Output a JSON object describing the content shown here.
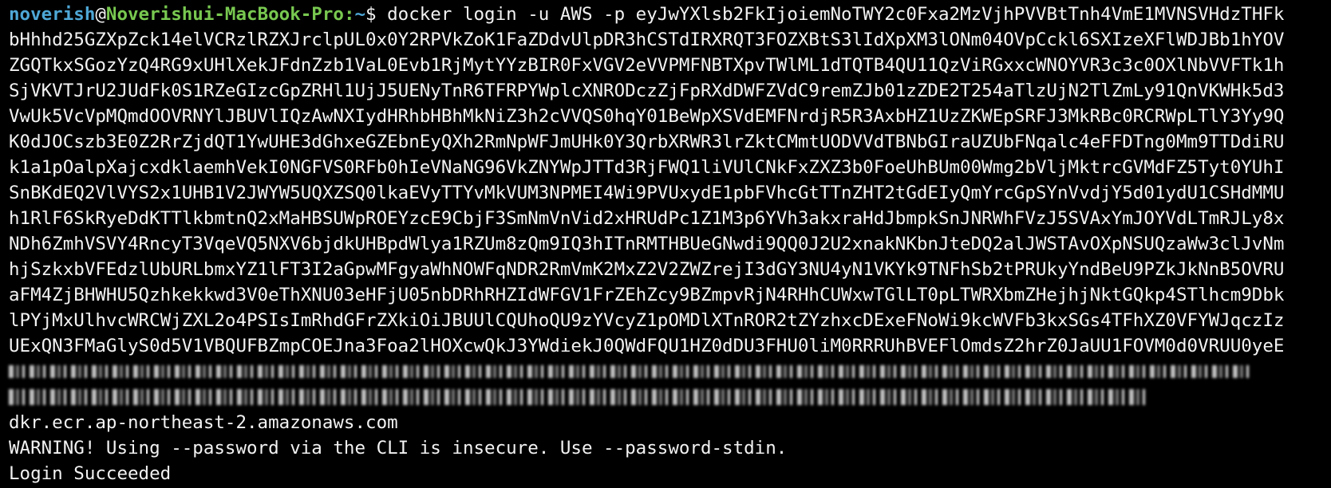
{
  "prompt": {
    "user": "noverish",
    "at": "@",
    "host": "Noverishui-MacBook-Pro",
    "colon": ":",
    "path": "~",
    "dollar": "$",
    "command": " docker login -u AWS -p eyJwYXlsb2FkIjoiemNoTWY2c0Fxa2MzVjhPVVBtTnh4VmE1MVNSVHdzTHFk"
  },
  "token_lines": [
    "bHhhd25GZXpZck14elVCRzlRZXJrclpUL0x0Y2RPVkZoK1FaZDdvUlpDR3hCSTdIRXRQT3FOZXBtS3lIdXpXM3lONm04OVpCckl6SXIzeXFlWDJBb1hYOV",
    "ZGQTkxSGozYzQ4RG9xUHlXekJFdnZzb1VaL0Evb1RjMytYYzBIR0FxVGV2eVVPMFNBTXpvTWlML1dTQTB4QU11QzViRGxxcWNOYVR3c3c0OXlNbVVFTk1h",
    "SjVKVTJrU2JUdFk0S1RZeGIzcGpZRHl1UjJ5UENyTnR6TFRPYWplcXNRODczZjFpRXdDWFZVdC9remZJb01zZDE2T254aTlzUjN2TlZmLy91QnVKWHk5d3",
    "VwUk5VcVpMQmdOOVRNYlJBUVlIQzAwNXIydHRhbHBhMkNiZ3h2cVVQS0hqY01BeWpXSVdEMFNrdjR5R3AxbHZ1UzZKWEpSRFJ3MkRBc0RCRWpLTlY3Yy9Q",
    "K0dJOCszb3E0Z2RrZjdQT1YwUHE3dGhxeGZEbnEyQXh2RmNpWFJmUHk0Y3QrbXRWR3lrZktCMmtUODVVdTBNbGIraUZUbFNqalc4eFFDTng0Mm9TTDdiRU",
    "k1a1pOalpXajcxdklaemhVekI0NGFVS0RFb0hIeVNaNG96VkZNYWpJTTd3RjFWQ1liVUlCNkFxZXZ3b0FoeUhBUm00Wmg2bVljMktrcGVMdFZ5Tyt0YUhI",
    "SnBKdEQ2VlVYS2x1UHB1V2JWYW5UQXZSQ0lkaEVyTTYvMkVUM3NPMEI4Wi9PVUxydE1pbFVhcGtTTnZHT2tGdEIyQmYrcGpSYnVvdjY5d01ydU1CSHdMMU",
    "h1RlF6SkRyeDdKTTlkbmtnQ2xMaHBSUWpROEYzcE9CbjF3SmNmVnVid2xHRUdPc1Z1M3p6YVh3akxraHdJbmpkSnJNRWhFVzJ5SVAxYmJOYVdLTmRJLy8x",
    "NDh6ZmhVSVY4RncyT3VqeVQ5NXV6bjdkUHBpdWlya1RZUm8zQm9IQ3hITnRMTHBUeGNwdi9QQ0J2U2xnakNKbnJteDQ2alJWSTAvOXpNSUQzaWw3clJvNm",
    "hjSzkxbVFEdzlUbURLbmxYZ1lFT3I2aGpwMFgyaWhNOWFqNDR2RmVmK2MxZ2V2ZWZrejI3dGY3NU4yN1VKYk9TNFhSb2tPRUkyYndBeU9PZkJkNnB5OVRU",
    "aFM4ZjBHWHU5Qzhkekkwd3V0eThXNU03eHFjU05nbDRhRHZIdWFGV1FrZEhZcy9BZmpvRjN4RHhCUWxwTGlLT0pLTWRXbmZHejhjNktGQkp4STlhcm9Dbk",
    "lPYjMxUlhvcWRCWjZXL2o4PSIsImRhdGFrZXkiOiJBUUlCQUhoQU9zYVcyZ1pOMDlXTnROR2tZYzhxcDExeFNoWi9kcWVFb3kxSGs4TFhXZ0VFYWJqczIz",
    "UExQN3FMaGlyS0d5V1VBQUFBZmpCOEJna3Foa2lHOXcwQkJ3YWdiekJ0QWdFQU1HZ0dDU3FHU0liM0RRRUhBVEFlOmdsZ2hrZ0JaUU1FOVM0d0VRUU0yeE"
  ],
  "redacted_label": "redacted text",
  "output_lines": [
    "dkr.ecr.ap-northeast-2.amazonaws.com",
    "WARNING! Using --password via the CLI is insecure. Use --password-stdin.",
    "Login Succeeded"
  ],
  "colors": {
    "background": "#000000",
    "text": "#f2f2f2",
    "user": "#4ea7d6",
    "host": "#78c850",
    "path": "#4ea7d6"
  }
}
